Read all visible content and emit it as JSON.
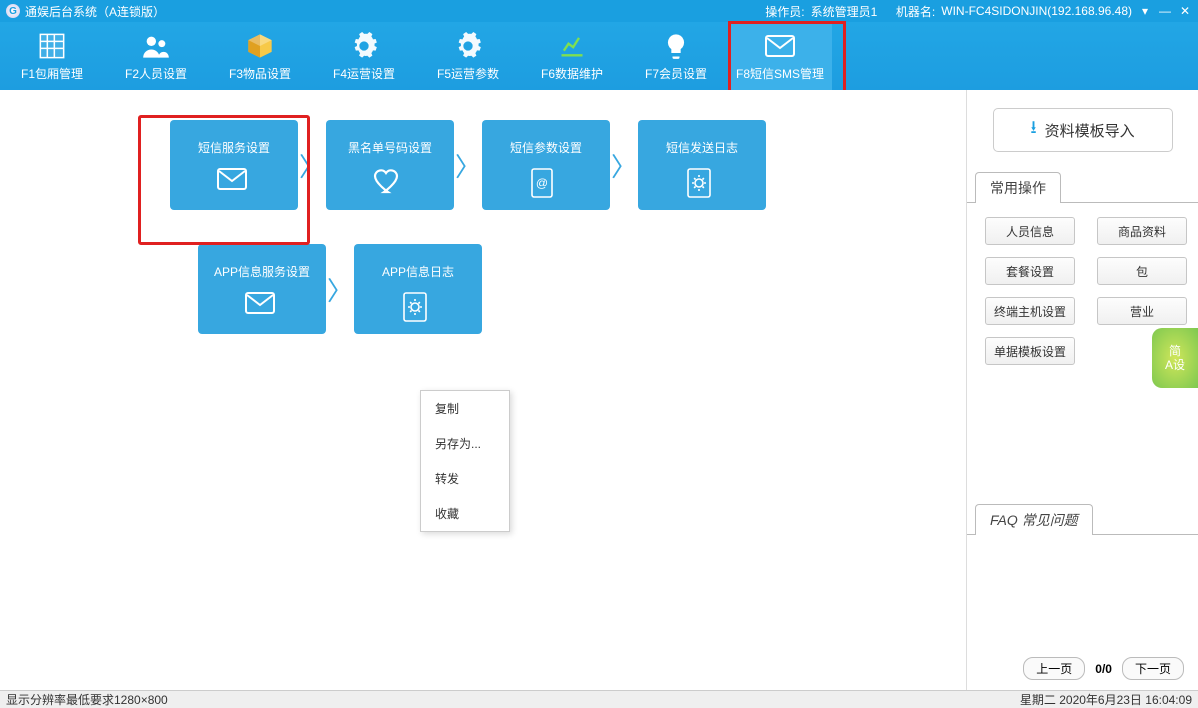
{
  "title": "通娱后台系统（A连锁版）",
  "header_right": {
    "operator_label": "操作员:",
    "operator": "系统管理员1",
    "machine_label": "机器名:",
    "machine": "WIN-FC4SIDONJIN(192.168.96.48)"
  },
  "toolbar": [
    {
      "label": "F1包厢管理",
      "icon": "grid"
    },
    {
      "label": "F2人员设置",
      "icon": "users"
    },
    {
      "label": "F3物品设置",
      "icon": "box"
    },
    {
      "label": "F4运营设置",
      "icon": "gear"
    },
    {
      "label": "F5运营参数",
      "icon": "gear2"
    },
    {
      "label": "F6数据维护",
      "icon": "chart"
    },
    {
      "label": "F7会员设置",
      "icon": "bulb"
    },
    {
      "label": "F8短信SMS管理",
      "icon": "mail",
      "active": true
    }
  ],
  "tiles_row1": [
    {
      "label": "短信服务设置",
      "icon": "mail"
    },
    {
      "label": "黑名单号码设置",
      "icon": "heart"
    },
    {
      "label": "短信参数设置",
      "icon": "at"
    },
    {
      "label": "短信发送日志",
      "icon": "cog"
    }
  ],
  "tiles_row2": [
    {
      "label": "APP信息服务设置",
      "icon": "mail"
    },
    {
      "label": "APP信息日志",
      "icon": "cog"
    }
  ],
  "context_menu": [
    "复制",
    "另存为...",
    "转发",
    "收藏"
  ],
  "sidebar": {
    "import_btn": "资料模板导入",
    "quick_title": "常用操作",
    "quick_buttons_full": [
      "人员信息",
      "商品资料",
      "套餐设置",
      "终端主机设置",
      "单据模板设置"
    ],
    "quick_buttons_half": [
      "包",
      "营业"
    ],
    "float_badge": "简\nA设",
    "faq_title": "FAQ 常见问题",
    "pager": {
      "prev": "上一页",
      "next": "下一页",
      "text": "0/0"
    }
  },
  "statusbar": {
    "left": "显示分辨率最低要求1280×800",
    "weekday": "星期二",
    "date": "2020年6月23日",
    "time": "16:04:09"
  }
}
